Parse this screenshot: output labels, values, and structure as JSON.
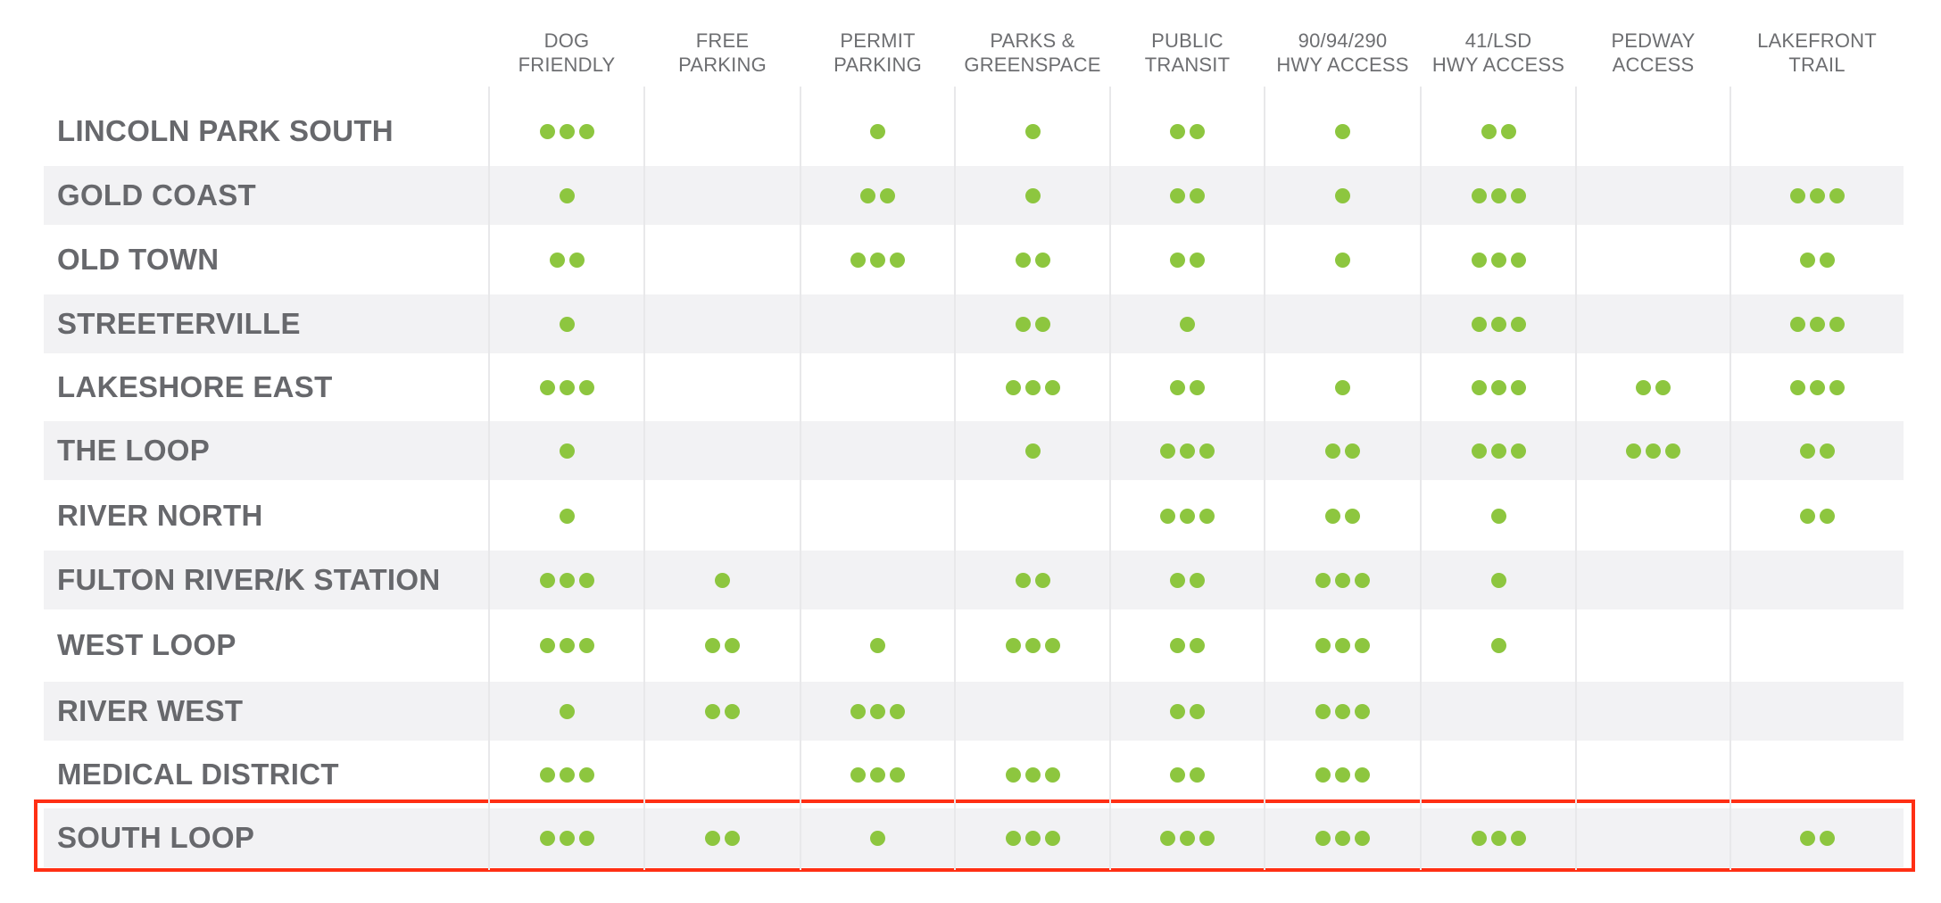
{
  "colors": {
    "dot": "#8dc63f",
    "highlight": "#ff2f14",
    "label": "#67686c",
    "header": "#6d6e71",
    "band": "#f2f2f4"
  },
  "columns": [
    {
      "key": "dog_friendly",
      "lines": [
        "DOG",
        "FRIENDLY"
      ]
    },
    {
      "key": "free_parking",
      "lines": [
        "FREE",
        "PARKING"
      ]
    },
    {
      "key": "permit_parking",
      "lines": [
        "PERMIT",
        "PARKING"
      ]
    },
    {
      "key": "parks_greenspace",
      "lines": [
        "PARKS &",
        "GREENSPACE"
      ]
    },
    {
      "key": "public_transit",
      "lines": [
        "PUBLIC",
        "TRANSIT"
      ]
    },
    {
      "key": "hwy_90_94_290",
      "lines": [
        "90/94/290",
        "HWY ACCESS"
      ]
    },
    {
      "key": "hwy_41_lsd",
      "lines": [
        "41/LSD",
        "HWY ACCESS"
      ]
    },
    {
      "key": "pedway_access",
      "lines": [
        "PEDWAY",
        "ACCESS"
      ]
    },
    {
      "key": "lakefront_trail",
      "lines": [
        "LAKEFRONT",
        "TRAIL"
      ]
    }
  ],
  "rows": [
    {
      "name": "LINCOLN PARK SOUTH",
      "ratings": [
        3,
        0,
        1,
        1,
        2,
        1,
        2,
        0,
        0
      ],
      "highlighted": false
    },
    {
      "name": "GOLD COAST",
      "ratings": [
        1,
        0,
        2,
        1,
        2,
        1,
        3,
        0,
        3
      ],
      "highlighted": false
    },
    {
      "name": "OLD TOWN",
      "ratings": [
        2,
        0,
        3,
        2,
        2,
        1,
        3,
        0,
        2
      ],
      "highlighted": false
    },
    {
      "name": "STREETERVILLE",
      "ratings": [
        1,
        0,
        0,
        2,
        1,
        0,
        3,
        0,
        3
      ],
      "highlighted": false
    },
    {
      "name": "LAKESHORE EAST",
      "ratings": [
        3,
        0,
        0,
        3,
        2,
        1,
        3,
        2,
        3
      ],
      "highlighted": false
    },
    {
      "name": "THE LOOP",
      "ratings": [
        1,
        0,
        0,
        1,
        3,
        2,
        3,
        3,
        2
      ],
      "highlighted": false
    },
    {
      "name": "RIVER NORTH",
      "ratings": [
        1,
        0,
        0,
        0,
        3,
        2,
        1,
        0,
        2
      ],
      "highlighted": false
    },
    {
      "name": "FULTON RIVER/K STATION",
      "ratings": [
        3,
        1,
        0,
        2,
        2,
        3,
        1,
        0,
        0
      ],
      "highlighted": false
    },
    {
      "name": "WEST LOOP",
      "ratings": [
        3,
        2,
        1,
        3,
        2,
        3,
        1,
        0,
        0
      ],
      "highlighted": false
    },
    {
      "name": "RIVER WEST",
      "ratings": [
        1,
        2,
        3,
        0,
        2,
        3,
        0,
        0,
        0
      ],
      "highlighted": false
    },
    {
      "name": "MEDICAL DISTRICT",
      "ratings": [
        3,
        0,
        3,
        3,
        2,
        3,
        0,
        0,
        0
      ],
      "highlighted": false
    },
    {
      "name": "SOUTH LOOP",
      "ratings": [
        3,
        2,
        1,
        3,
        3,
        3,
        3,
        0,
        2
      ],
      "highlighted": true
    }
  ]
}
